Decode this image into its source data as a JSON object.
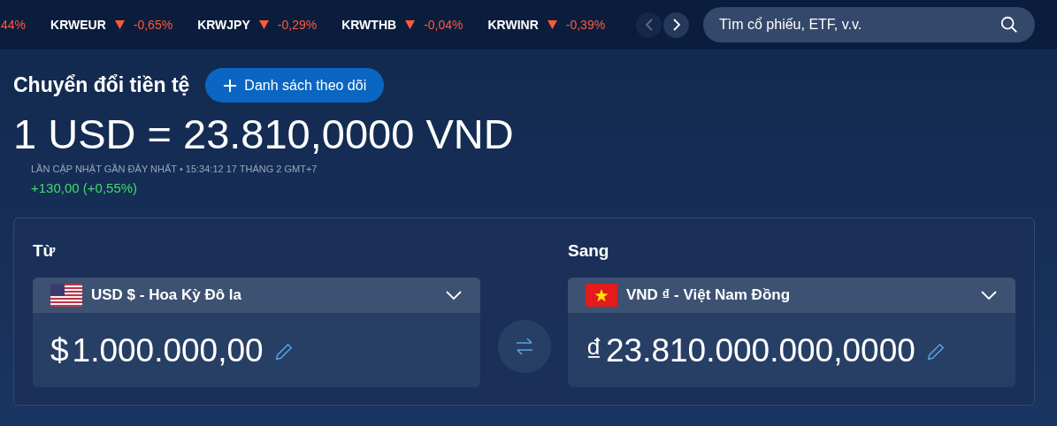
{
  "ticker": [
    {
      "change": "44%",
      "negative": true,
      "arrow": false
    },
    {
      "symbol": "KRWEUR",
      "change": "-0,65%",
      "negative": true,
      "arrow": true
    },
    {
      "symbol": "KRWJPY",
      "change": "-0,29%",
      "negative": true,
      "arrow": true
    },
    {
      "symbol": "KRWTHB",
      "change": "-0,04%",
      "negative": true,
      "arrow": true
    },
    {
      "symbol": "KRWINR",
      "change": "-0,39%",
      "negative": true,
      "arrow": true
    }
  ],
  "nav": {
    "prev_disabled": true,
    "next_disabled": false
  },
  "search": {
    "placeholder": "Tìm cổ phiếu, ETF, v.v."
  },
  "title": "Chuyển đổi tiền tệ",
  "watchlist_button": "Danh sách theo dõi",
  "rate": "1 USD = 23.810,0000 VND",
  "updated": "LẦN CẬP NHẬT GẦN ĐÂY NHẤT • 15:34:12 17 THÁNG 2 GMT+7",
  "change": {
    "text": "+130,00 (+0,55%)",
    "negative": false
  },
  "converter": [
    {
      "label": "Từ",
      "kind": "usa",
      "currency": "USD $ - Hoa Kỳ Đô la",
      "symbol": "$",
      "amount": "1.000.000,00"
    },
    {
      "label": "Sang",
      "kind": "vietnam",
      "currency": "VND ₫ - Việt Nam Đồng",
      "symbol": "₫",
      "amount": "23.810.000.000,0000"
    }
  ]
}
